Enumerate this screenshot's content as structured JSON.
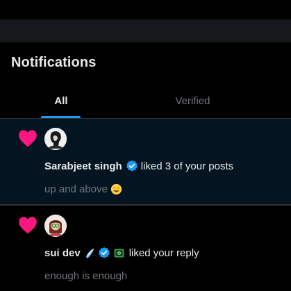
{
  "header": {
    "title": "Notifications"
  },
  "tabs": [
    {
      "label": "All",
      "active": true
    },
    {
      "label": "Verified",
      "active": false
    }
  ],
  "notifications": [
    {
      "type": "like",
      "icon": "heart-icon",
      "user_name": "Sarabjeet singh",
      "verified": true,
      "action": "liked 3 of your posts",
      "snippet": "up and above",
      "snippet_emoji": "star-struck-emoji"
    },
    {
      "type": "like",
      "icon": "heart-icon",
      "user_name": "sui dev",
      "name_emoji": [
        "droplet-emoji",
        "dollar-banknote-emoji"
      ],
      "verified": true,
      "action": "liked your reply",
      "snippet": "enough is enough"
    }
  ],
  "colors": {
    "background": "#000000",
    "highlight_row": "#041521",
    "accent_blue": "#1d9bf0",
    "like_pink": "#f91880",
    "muted_text": "#71767b",
    "primary_text": "#e7e9ea",
    "divider": "#2f3336"
  }
}
